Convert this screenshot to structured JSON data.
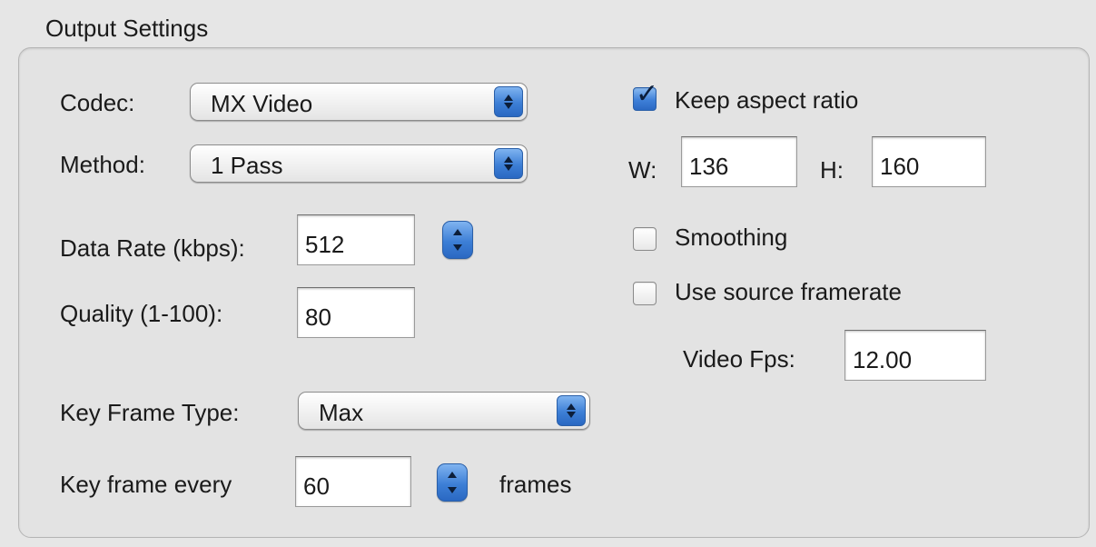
{
  "group": {
    "title": "Output Settings"
  },
  "codec": {
    "label": "Codec:",
    "value": "MX Video"
  },
  "method": {
    "label": "Method:",
    "value": "1 Pass"
  },
  "data_rate": {
    "label": "Data Rate (kbps):",
    "value": "512"
  },
  "quality": {
    "label": "Quality (1-100):",
    "value": "80"
  },
  "key_frame_type": {
    "label": "Key Frame Type:",
    "value": "Max"
  },
  "key_frame_every": {
    "label": "Key frame every",
    "value": "60",
    "unit": "frames"
  },
  "keep_aspect": {
    "label": "Keep aspect ratio",
    "checked": true
  },
  "dimensions": {
    "w_label": "W:",
    "w_value": "136",
    "h_label": "H:",
    "h_value": "160"
  },
  "smoothing": {
    "label": "Smoothing",
    "checked": false
  },
  "use_source_framerate": {
    "label": "Use source framerate",
    "checked": false
  },
  "video_fps": {
    "label": "Video Fps:",
    "value": "12.00"
  },
  "icons": {
    "popup_arrows": "up-down-chevron-icon",
    "stepper": "stepper-arrows-icon",
    "checkmark": "checkmark-icon"
  },
  "colors": {
    "accent": "#3d7fd6",
    "background": "#e6e6e6"
  }
}
